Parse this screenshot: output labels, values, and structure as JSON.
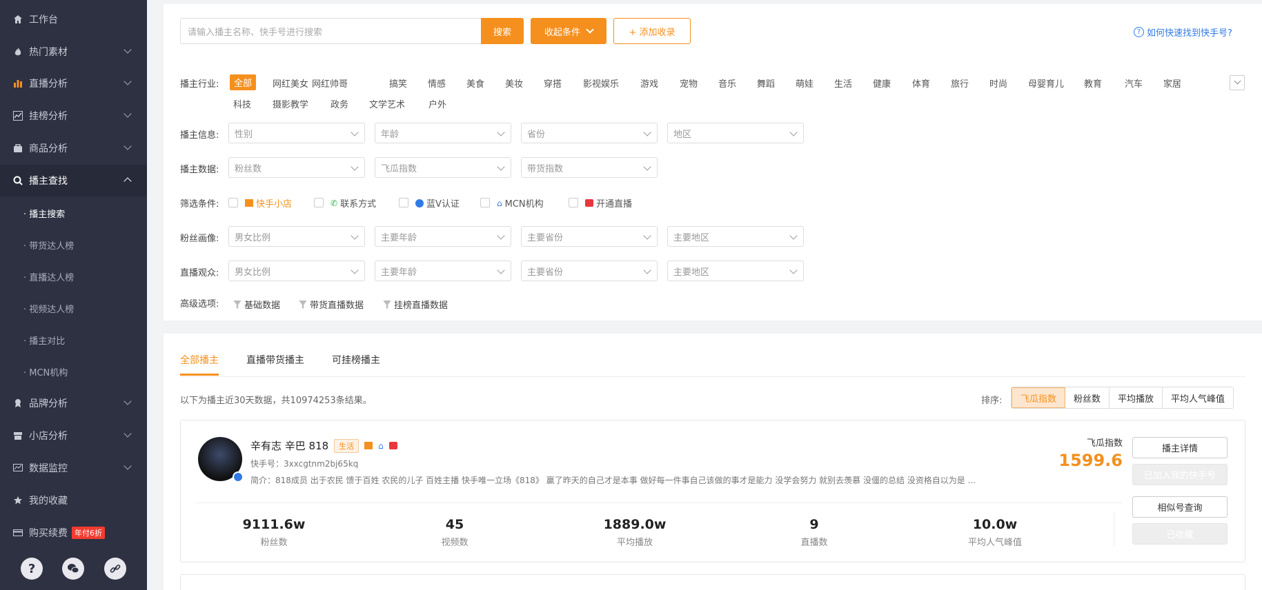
{
  "sidebar": {
    "items": [
      {
        "label": "工作台",
        "icon": "home-icon"
      },
      {
        "label": "热门素材",
        "icon": "fire-icon"
      },
      {
        "label": "直播分析",
        "icon": "bar-chart-icon"
      },
      {
        "label": "挂榜分析",
        "icon": "line-chart-icon"
      },
      {
        "label": "商品分析",
        "icon": "bag-icon"
      },
      {
        "label": "播主查找",
        "icon": "search-icon"
      },
      {
        "label": "品牌分析",
        "icon": "award-icon"
      },
      {
        "label": "小店分析",
        "icon": "store-icon"
      },
      {
        "label": "数据监控",
        "icon": "monitor-icon"
      },
      {
        "label": "我的收藏",
        "icon": "star-icon"
      },
      {
        "label": "购买续费",
        "icon": "card-icon",
        "badge": "年付6折"
      }
    ],
    "sub_items": [
      "· 播主搜索",
      "· 带货达人榜",
      "· 直播达人榜",
      "· 视频达人榜",
      "· 播主对比",
      "· MCN机构"
    ],
    "bottom_icons": [
      "help-icon",
      "wechat-icon",
      "link-icon"
    ]
  },
  "search": {
    "placeholder": "请输入播主名称、快手号进行搜索",
    "search_label": "搜索",
    "collapse_label": "收起条件",
    "add_label": "+ 添加收录",
    "help_link": "如何快速找到快手号?"
  },
  "filters": {
    "industry_label": "播主行业:",
    "industries": [
      "全部",
      "网红美女",
      "网红帅哥",
      "搞笑",
      "情感",
      "美食",
      "美妆",
      "穿搭",
      "影视娱乐",
      "游戏",
      "宠物",
      "音乐",
      "舞蹈",
      "萌娃",
      "生活",
      "健康",
      "体育",
      "旅行",
      "时尚",
      "母婴育儿",
      "教育",
      "汽车",
      "家居",
      "科技",
      "摄影教学",
      "政务",
      "文学艺术",
      "户外"
    ],
    "info_label": "播主信息:",
    "info_selects": [
      "性别",
      "年龄",
      "省份",
      "地区"
    ],
    "data_label": "播主数据:",
    "data_selects": [
      "粉丝数",
      "飞瓜指数",
      "带货指数"
    ],
    "condition_label": "筛选条件:",
    "conditions": [
      "快手小店",
      "联系方式",
      "蓝V认证",
      "MCN机构",
      "开通直播"
    ],
    "fans_label": "粉丝画像:",
    "fans_selects": [
      "男女比例",
      "主要年龄",
      "主要省份",
      "主要地区"
    ],
    "audience_label": "直播观众:",
    "audience_selects": [
      "男女比例",
      "主要年龄",
      "主要省份",
      "主要地区"
    ],
    "advanced_label": "高级选项:",
    "advanced": [
      "基础数据",
      "带货直播数据",
      "挂榜直播数据"
    ]
  },
  "results": {
    "tabs": [
      "全部播主",
      "直播带货播主",
      "可挂榜播主"
    ],
    "summary": "以下为播主近30天数据，共10974253条结果。",
    "sort_label": "排序:",
    "sort_options": [
      "飞瓜指数",
      "粉丝数",
      "平均播放",
      "平均人气峰值"
    ]
  },
  "card": {
    "name": "辛有志 辛巴 818",
    "category": "生活",
    "kuaishou_id": "快手号：3xxcgtnm2bj65kq",
    "bio": "简介：818成员 出于农民 馈于百姓 农民的儿子 百姓主播 快手唯一立场《818》 赢了昨天的自己才是本事 做好每一件事自己该做的事才是能力 没学会努力 就别去羡慕 没僵的总结 没资格自以为是 ...",
    "index_label": "飞瓜指数",
    "index_value": "1599.6",
    "stats": [
      {
        "value": "9111.6w",
        "label": "粉丝数"
      },
      {
        "value": "45",
        "label": "视频数"
      },
      {
        "value": "1889.0w",
        "label": "平均播放"
      },
      {
        "value": "9",
        "label": "直播数"
      },
      {
        "value": "10.0w",
        "label": "平均人气峰值"
      }
    ],
    "buttons": [
      "播主详情",
      "已加入我的快手号",
      "相似号查询",
      "已收藏"
    ]
  },
  "colors": {
    "accent": "#f5901e",
    "sidebar_bg": "#2d3142",
    "badge_red": "#f23b2f"
  }
}
